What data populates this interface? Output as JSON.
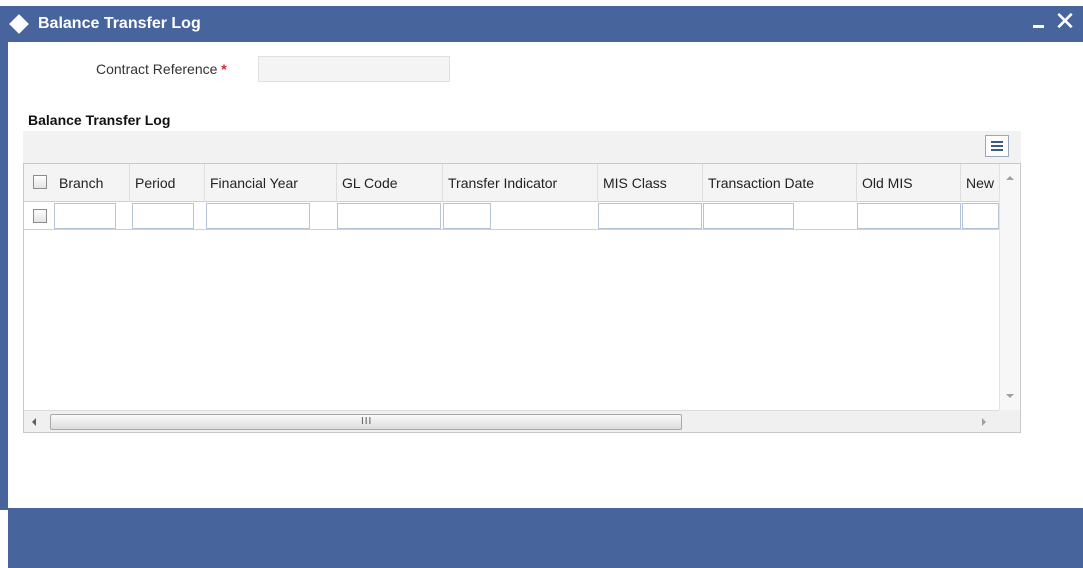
{
  "window": {
    "title": "Balance Transfer Log",
    "minimize_label": "",
    "close_label": "✕"
  },
  "form": {
    "contract_reference_label": "Contract Reference",
    "required_marker": "*",
    "contract_reference_value": ""
  },
  "section": {
    "title": "Balance Transfer Log"
  },
  "grid": {
    "columns": [
      "Branch",
      "Period",
      "Financial Year",
      "GL Code",
      "Transfer Indicator",
      "MIS Class",
      "Transaction Date",
      "Old MIS",
      "New"
    ],
    "rows": [
      {
        "checked": false,
        "values": [
          "",
          "",
          "",
          "",
          "",
          "",
          "",
          "",
          ""
        ]
      }
    ],
    "hscroll_grip": "III"
  },
  "icons": {
    "title_icon": "diamond-icon",
    "grid_settings": "list-view-icon"
  },
  "colors": {
    "titlebar": "#47659c",
    "footer": "#47659c",
    "required": "#d8242b"
  }
}
